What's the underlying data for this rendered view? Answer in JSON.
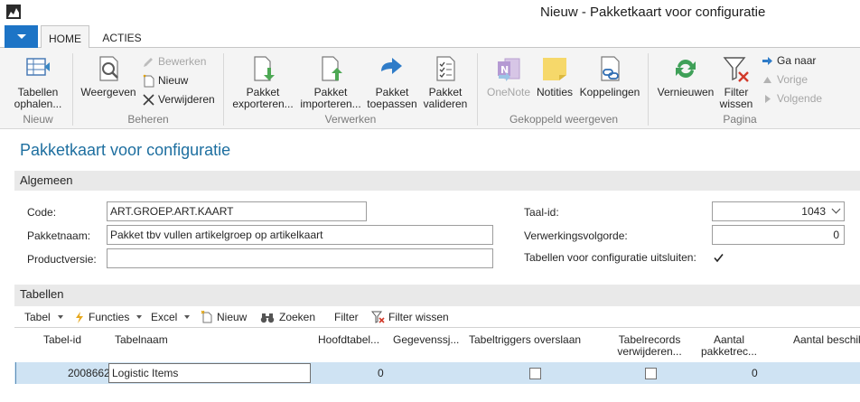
{
  "window": {
    "title": "Nieuw - Pakketkaart voor configuratie"
  },
  "ribbon": {
    "tabs": [
      "HOME",
      "ACTIES"
    ],
    "groups": {
      "nieuw": {
        "label": "Nieuw",
        "tabellen_ophalen": [
          "Tabellen",
          "ophalen..."
        ]
      },
      "beheren": {
        "label": "Beheren",
        "weergeven": "Weergeven",
        "bewerken": "Bewerken",
        "nieuw": "Nieuw",
        "verwijderen": "Verwijderen"
      },
      "verwerken": {
        "label": "Verwerken",
        "pakket_exporteren": [
          "Pakket",
          "exporteren..."
        ],
        "pakket_importeren": [
          "Pakket",
          "importeren..."
        ],
        "pakket_toepassen": [
          "Pakket",
          "toepassen"
        ],
        "pakket_valideren": [
          "Pakket",
          "valideren"
        ]
      },
      "gekoppeld": {
        "label": "Gekoppeld weergeven",
        "onenote": "OneNote",
        "notities": "Notities",
        "koppelingen": "Koppelingen"
      },
      "pagina": {
        "label": "Pagina",
        "vernieuwen": "Vernieuwen",
        "filter_wissen": [
          "Filter",
          "wissen"
        ],
        "ga_naar": "Ga naar",
        "vorige": "Vorige",
        "volgende": "Volgende"
      }
    }
  },
  "page": {
    "title": "Pakketkaart voor configuratie"
  },
  "algemeen": {
    "header": "Algemeen",
    "code_label": "Code:",
    "code_value": "ART.GROEP.ART.KAART",
    "pakketnaam_label": "Pakketnaam:",
    "pakketnaam_value": "Pakket tbv vullen artikelgroep op artikelkaart",
    "productversie_label": "Productversie:",
    "productversie_value": "",
    "taal_label": "Taal-id:",
    "taal_value": "1043",
    "verwerkingsvolgorde_label": "Verwerkingsvolgorde:",
    "verwerkingsvolgorde_value": "0",
    "uitsluiten_label": "Tabellen voor configuratie uitsluiten:",
    "uitsluiten_checked": true
  },
  "tabellen": {
    "header": "Tabellen",
    "toolbar": {
      "tabel": "Tabel",
      "functies": "Functies",
      "excel": "Excel",
      "nieuw": "Nieuw",
      "zoeken": "Zoeken",
      "filter": "Filter",
      "filter_wissen": "Filter wissen"
    },
    "columns": {
      "tabel_id": "Tabel-id",
      "tabelnaam": "Tabelnaam",
      "hoofdtabel": "Hoofdtabel...",
      "gegevenssj": "Gegevenssj...",
      "triggers": "Tabeltriggers overslaan",
      "verwijderen": [
        "Tabelrecords",
        "verwijderen..."
      ],
      "aantal_pakket": [
        "Aantal",
        "pakketrec..."
      ],
      "aantal_beschik": "Aantal beschik"
    },
    "rows": [
      {
        "tabel_id": "2008662",
        "tabelnaam": "Logistic Items",
        "hoofdtabel": "0",
        "triggers": false,
        "verwijderen": false,
        "aantal": "0"
      }
    ]
  }
}
